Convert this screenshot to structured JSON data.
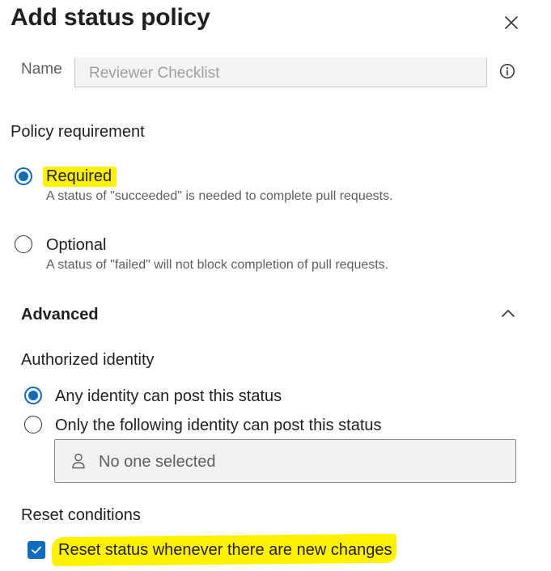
{
  "panel": {
    "title": "Add status policy"
  },
  "name_field": {
    "label": "Name",
    "placeholder": "Reviewer Checklist"
  },
  "policy_requirement": {
    "label": "Policy requirement",
    "options": [
      {
        "label": "Required",
        "description": "A status of \"succeeded\" is needed to complete pull requests.",
        "selected": true
      },
      {
        "label": "Optional",
        "description": "A status of \"failed\" will not block completion of pull requests.",
        "selected": false
      }
    ]
  },
  "advanced": {
    "title": "Advanced",
    "expanded": true,
    "authorized_identity": {
      "label": "Authorized identity",
      "options": [
        {
          "label": "Any identity can post this status",
          "selected": true
        },
        {
          "label": "Only the following identity can post this status",
          "selected": false
        }
      ],
      "picker_placeholder": "No one selected"
    },
    "reset_conditions": {
      "label": "Reset conditions",
      "checkbox_label": "Reset status whenever there are new changes",
      "checked": true
    }
  },
  "colors": {
    "accent": "#0f6cbd",
    "highlight": "#fff200",
    "text_primary": "#201f1e",
    "text_secondary": "#605e5c"
  }
}
